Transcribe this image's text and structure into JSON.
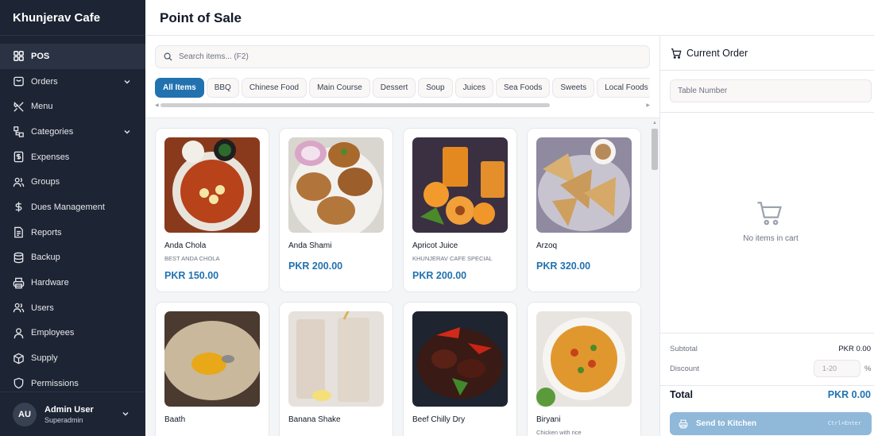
{
  "app": {
    "brand": "Khunjerav Cafe",
    "page_title": "Point of Sale"
  },
  "colors": {
    "sidebar_bg": "#1d2433",
    "accent": "#2272b0",
    "send_button": "#8fb8d9"
  },
  "sidebar": {
    "items": [
      {
        "label": "POS",
        "icon": "grid-icon",
        "active": true
      },
      {
        "label": "Orders",
        "icon": "orders-icon",
        "expandable": true
      },
      {
        "label": "Menu",
        "icon": "utensils-icon"
      },
      {
        "label": "Categories",
        "icon": "categories-icon",
        "expandable": true
      },
      {
        "label": "Expenses",
        "icon": "expenses-icon"
      },
      {
        "label": "Groups",
        "icon": "groups-icon"
      },
      {
        "label": "Dues Management",
        "icon": "dollar-icon"
      },
      {
        "label": "Reports",
        "icon": "reports-icon"
      },
      {
        "label": "Backup",
        "icon": "database-icon"
      },
      {
        "label": "Hardware",
        "icon": "printer-icon"
      },
      {
        "label": "Users",
        "icon": "users-icon"
      },
      {
        "label": "Employees",
        "icon": "employee-icon"
      },
      {
        "label": "Supply",
        "icon": "package-icon"
      },
      {
        "label": "Permissions",
        "icon": "shield-icon"
      }
    ],
    "user": {
      "initials": "AU",
      "name": "Admin User",
      "role": "Superadmin"
    }
  },
  "search": {
    "placeholder": "Search items... (F2)"
  },
  "categories": [
    "All Items",
    "BBQ",
    "Chinese Food",
    "Main Course",
    "Dessert",
    "Soup",
    "Juices",
    "Sea Foods",
    "Sweets",
    "Local Foods"
  ],
  "products": [
    {
      "name": "Anda Chola",
      "description": "BEST ANDA CHOLA",
      "price": "PKR 150.00",
      "image": "anda-chola-photo"
    },
    {
      "name": "Anda Shami",
      "description": "",
      "price": "PKR 200.00",
      "image": "anda-shami-photo"
    },
    {
      "name": "Apricot Juice",
      "description": "KHUNJERAV CAFE SPECIAL",
      "price": "PKR 200.00",
      "image": "apricot-juice-photo"
    },
    {
      "name": "Arzoq",
      "description": "",
      "price": "PKR 320.00",
      "image": "arzoq-photo"
    },
    {
      "name": "Baath",
      "description": "",
      "price": "",
      "image": "baath-photo"
    },
    {
      "name": "Banana Shake",
      "description": "",
      "price": "",
      "image": "banana-shake-photo"
    },
    {
      "name": "Beef Chilly Dry",
      "description": "",
      "price": "",
      "image": "beef-chilly-dry-photo"
    },
    {
      "name": "Biryani",
      "description": "Chicken with rice",
      "price": "",
      "image": "biryani-photo"
    }
  ],
  "order": {
    "title": "Current Order",
    "table_placeholder": "Table Number",
    "empty_text": "No items in cart",
    "subtotal_label": "Subtotal",
    "subtotal_value": "PKR 0.00",
    "discount_label": "Discount",
    "discount_placeholder": "1-20",
    "discount_unit": "%",
    "total_label": "Total",
    "total_value": "PKR 0.00",
    "send_label": "Send to Kitchen",
    "send_shortcut": "Ctrl+Enter"
  }
}
